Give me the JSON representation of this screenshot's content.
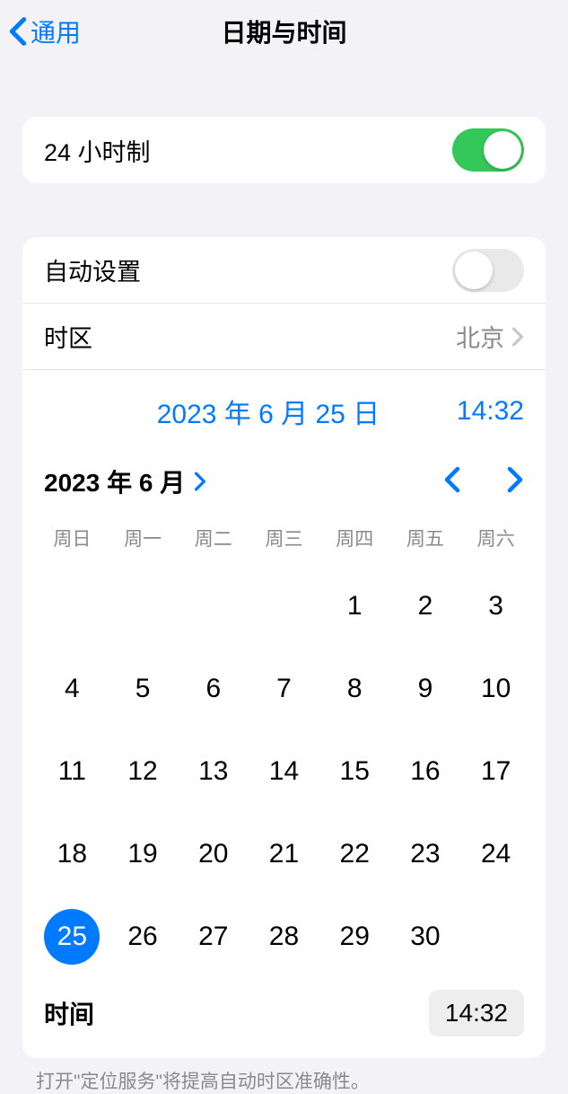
{
  "header": {
    "back_label": "通用",
    "title": "日期与时间"
  },
  "settings": {
    "twenty_four_hour_label": "24 小时制",
    "twenty_four_hour_on": true,
    "auto_set_label": "自动设置",
    "auto_set_on": false,
    "timezone_label": "时区",
    "timezone_value": "北京"
  },
  "datetime": {
    "current_date_display": "2023 年 6 月 25 日",
    "current_time_display": "14:32",
    "month_label": "2023 年 6 月",
    "weekdays": [
      "周日",
      "周一",
      "周二",
      "周三",
      "周四",
      "周五",
      "周六"
    ],
    "days": [
      {
        "n": "",
        "sel": false
      },
      {
        "n": "",
        "sel": false
      },
      {
        "n": "",
        "sel": false
      },
      {
        "n": "",
        "sel": false
      },
      {
        "n": "1",
        "sel": false
      },
      {
        "n": "2",
        "sel": false
      },
      {
        "n": "3",
        "sel": false
      },
      {
        "n": "4",
        "sel": false
      },
      {
        "n": "5",
        "sel": false
      },
      {
        "n": "6",
        "sel": false
      },
      {
        "n": "7",
        "sel": false
      },
      {
        "n": "8",
        "sel": false
      },
      {
        "n": "9",
        "sel": false
      },
      {
        "n": "10",
        "sel": false
      },
      {
        "n": "11",
        "sel": false
      },
      {
        "n": "12",
        "sel": false
      },
      {
        "n": "13",
        "sel": false
      },
      {
        "n": "14",
        "sel": false
      },
      {
        "n": "15",
        "sel": false
      },
      {
        "n": "16",
        "sel": false
      },
      {
        "n": "17",
        "sel": false
      },
      {
        "n": "18",
        "sel": false
      },
      {
        "n": "19",
        "sel": false
      },
      {
        "n": "20",
        "sel": false
      },
      {
        "n": "21",
        "sel": false
      },
      {
        "n": "22",
        "sel": false
      },
      {
        "n": "23",
        "sel": false
      },
      {
        "n": "24",
        "sel": false
      },
      {
        "n": "25",
        "sel": true
      },
      {
        "n": "26",
        "sel": false
      },
      {
        "n": "27",
        "sel": false
      },
      {
        "n": "28",
        "sel": false
      },
      {
        "n": "29",
        "sel": false
      },
      {
        "n": "30",
        "sel": false
      }
    ],
    "time_label": "时间",
    "time_value": "14:32"
  },
  "footer_note": "打开\"定位服务\"将提高自动时区准确性。"
}
